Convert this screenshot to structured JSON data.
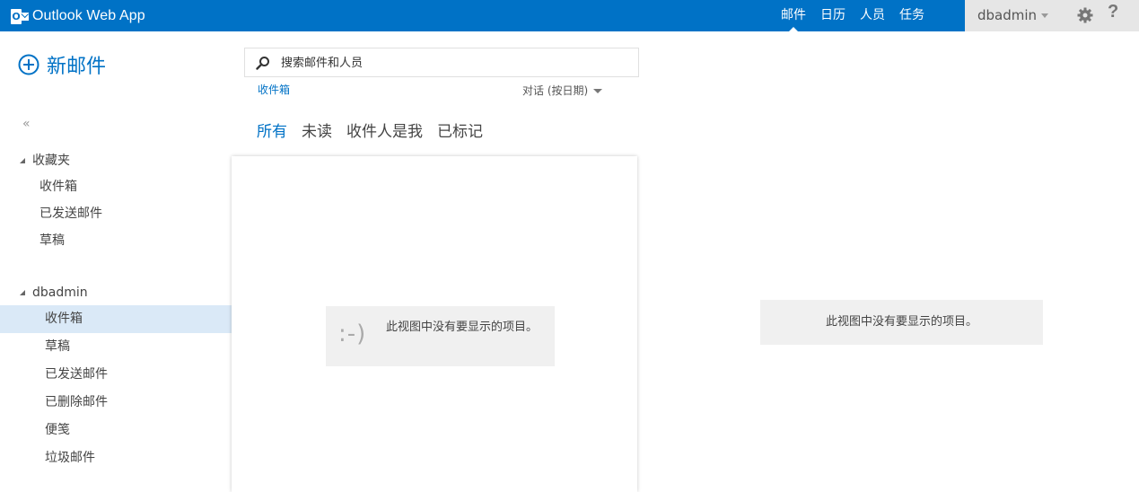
{
  "app": {
    "title": "Outlook Web App",
    "logo_letter": "O"
  },
  "topnav": {
    "items": [
      {
        "label": "邮件",
        "active": true
      },
      {
        "label": "日历",
        "active": false
      },
      {
        "label": "人员",
        "active": false
      },
      {
        "label": "任务",
        "active": false
      }
    ]
  },
  "user": {
    "name": "dbadmin"
  },
  "help_label": "?",
  "new_mail": {
    "label": "新邮件"
  },
  "collapse_label": "«",
  "favorites": {
    "title": "收藏夹",
    "folders": [
      "收件箱",
      "已发送邮件",
      "草稿"
    ]
  },
  "account": {
    "title": "dbadmin",
    "folders": [
      "收件箱",
      "草稿",
      "已发送邮件",
      "已删除邮件",
      "便笺",
      "垃圾邮件"
    ],
    "selected": "收件箱"
  },
  "search": {
    "placeholder": "搜索邮件和人员",
    "value": ""
  },
  "breadcrumb": "收件箱",
  "sort_by": "对话 (按日期)",
  "filters": [
    "所有",
    "未读",
    "收件人是我",
    "已标记"
  ],
  "list_empty": {
    "smiley": ":-)",
    "message": "此视图中没有要显示的项目。"
  },
  "reading_empty": {
    "message": "此视图中没有要显示的项目。"
  },
  "colors": {
    "accent": "#0072c6",
    "selected_bg": "#dae9f7",
    "panel_gray": "#f0f0f0"
  }
}
